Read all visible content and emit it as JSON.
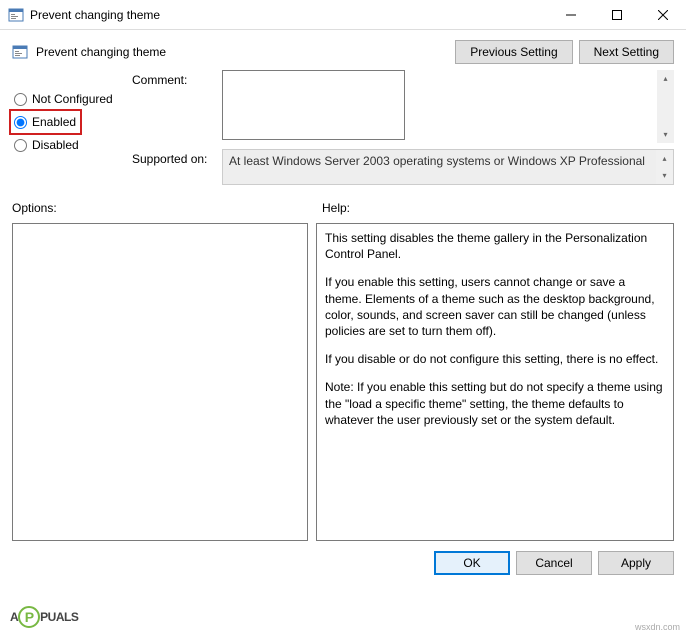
{
  "window": {
    "title": "Prevent changing theme"
  },
  "header": {
    "title": "Prevent changing theme",
    "prev_btn": "Previous Setting",
    "next_btn": "Next Setting"
  },
  "radios": {
    "not_configured": "Not Configured",
    "enabled": "Enabled",
    "disabled": "Disabled",
    "selected": "enabled"
  },
  "fields": {
    "comment_label": "Comment:",
    "comment_value": "",
    "supported_label": "Supported on:",
    "supported_value": "At least Windows Server 2003 operating systems or Windows XP Professional"
  },
  "sections": {
    "options_label": "Options:",
    "help_label": "Help:"
  },
  "help": {
    "p1": "This setting disables the theme gallery in the Personalization Control Panel.",
    "p2": "If you enable this setting, users cannot change or save a theme. Elements of a theme such as the desktop background, color, sounds, and screen saver can still be changed (unless policies are set to turn them off).",
    "p3": "If you disable or do not configure this setting, there is no effect.",
    "p4": "Note: If you enable this setting but do not specify a theme using the \"load a specific theme\" setting, the theme defaults to whatever the user previously set or the system default."
  },
  "footer": {
    "ok": "OK",
    "cancel": "Cancel",
    "apply": "Apply"
  },
  "watermark": {
    "text_left": "A",
    "text_right": "PUALS",
    "url": "wsxdn.com"
  }
}
